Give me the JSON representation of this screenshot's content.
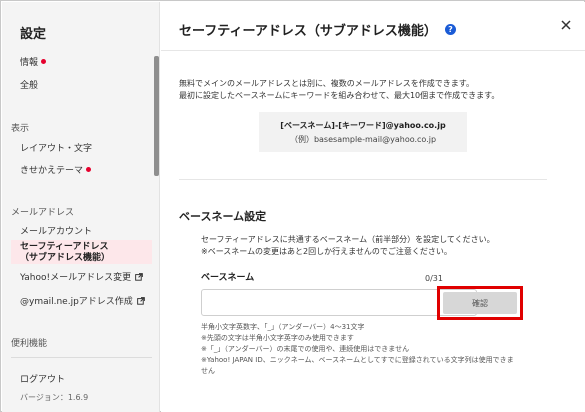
{
  "sidebar": {
    "title": "設定",
    "items": [
      {
        "label": "情報",
        "dot": true
      },
      {
        "label": "全般"
      },
      {
        "label": "レイアウト・文字"
      },
      {
        "label": "きせかえテーマ",
        "dot": true
      },
      {
        "label": "メールアカウント"
      },
      {
        "label": "セーフティーアドレス\n（サブアドレス機能）",
        "active": true
      },
      {
        "label": "Yahoo!メールアドレス変更",
        "external": true
      },
      {
        "label": "@ymail.ne.jpアドレス作成",
        "external": true
      },
      {
        "label": "ログアウト"
      }
    ],
    "sections": [
      "表示",
      "メールアドレス",
      "便利機能"
    ],
    "version": "バージョン：1.6.9"
  },
  "main": {
    "title": "セーフティーアドレス（サブアドレス機能）",
    "help_icon": "?",
    "intro_line1": "無料でメインのメールアドレスとは別に、複数のメールアドレスを作成できます。",
    "intro_line2": "最初に設定したベースネームにキーワードを組み合わせて、最大10個まで作成できます。",
    "format": "[ベースネーム]-[キーワード]@yahoo.co.jp",
    "sample": "（例）basesample-mail@yahoo.co.jp",
    "section_title": "ベースネーム設定",
    "desc_line1": "セーフティーアドレスに共通するベースネーム（前半部分）を設定してください。",
    "desc_line2": "※ベースネームの変更はあと2回しか行えませんのでご注意ください。",
    "field_label": "ベースネーム",
    "counter": "0/31",
    "input_value": "",
    "confirm_label": "確認",
    "notes": [
      "半角小文字英数字、「_」（アンダーバー）4〜31文字",
      "※先頭の文字は半角小文字英字のみ使用できます",
      "※「_」（アンダーバー）の末尾での使用や、連続使用はできません",
      "※Yahoo! JAPAN ID、ニックネーム、ベースネームとしてすでに登録されている文字列は使用できま",
      "せん"
    ]
  },
  "colors": {
    "accent_red": "#e5002d",
    "help_blue": "#1a5bd6",
    "active_bg": "#fde7ea",
    "highlight": "#e00000"
  }
}
